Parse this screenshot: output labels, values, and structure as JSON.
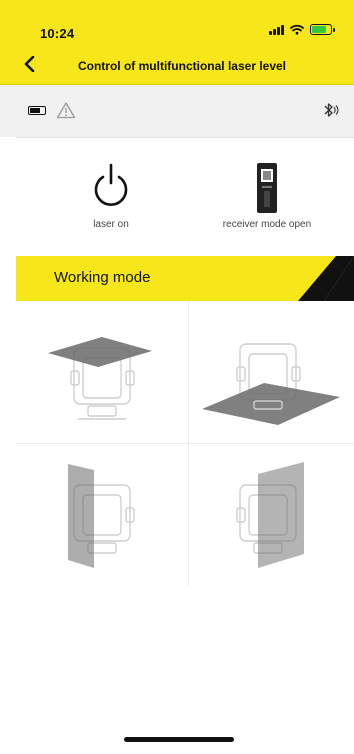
{
  "status_bar": {
    "time": "10:24"
  },
  "header": {
    "title": "Control of multifunctional laser level"
  },
  "controls": {
    "laser": {
      "label": "laser on"
    },
    "receiver": {
      "label": "receiver mode open"
    }
  },
  "working_mode": {
    "title": "Working mode"
  },
  "colors": {
    "accent": "#f7e61a",
    "dark": "#111111",
    "panel": "#f1f1f1"
  },
  "icons": [
    "back-icon",
    "battery-icon",
    "warning-icon",
    "bluetooth-icon",
    "power-icon",
    "receiver-icon"
  ]
}
